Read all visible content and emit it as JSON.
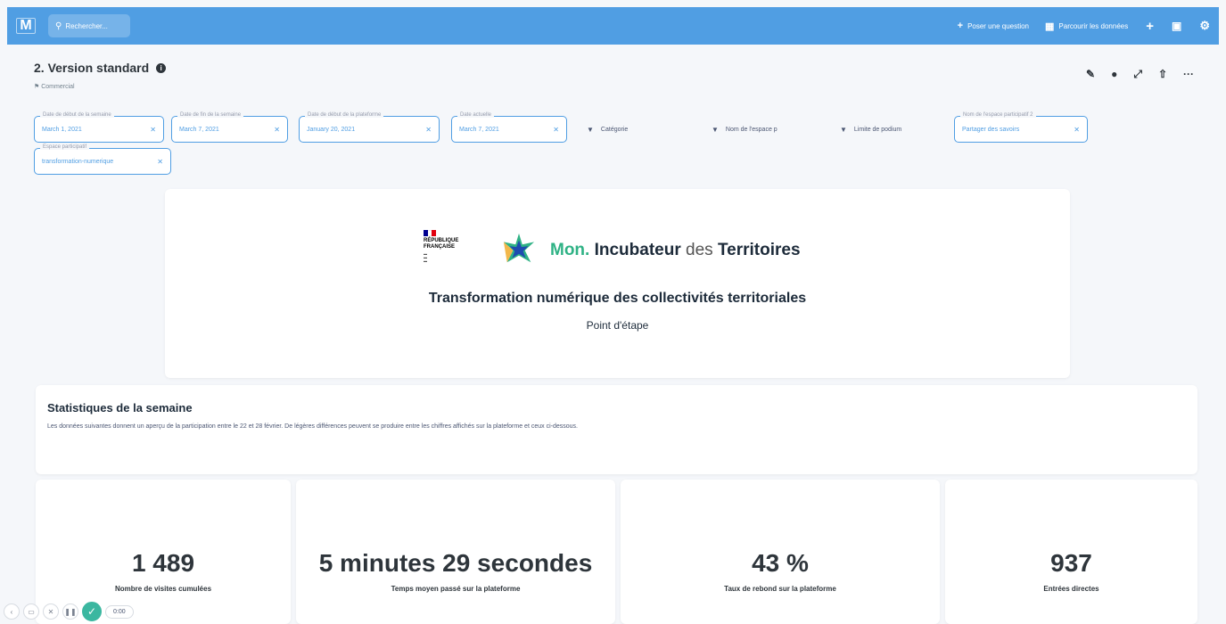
{
  "topbar": {
    "logo": "M",
    "search_placeholder": "Rechercher...",
    "new_question": "Poser une question",
    "browse_data": "Parcourir les données",
    "icons": [
      "plus-icon",
      "dashboard-icon",
      "gear-icon"
    ]
  },
  "header": {
    "title": "2. Version standard",
    "collection": "Commercial"
  },
  "filters": [
    {
      "label": "Date de début de la semaine",
      "value": "March 1, 2021"
    },
    {
      "label": "Date de fin de la semaine",
      "value": "March 7, 2021"
    },
    {
      "label": "Date de début de la plateforme",
      "value": "January 20, 2021"
    },
    {
      "label": "Date actuelle",
      "value": "March 7, 2021"
    },
    {
      "label": "Nom de l'espace participatif 2",
      "value": "Partager des savoirs"
    },
    {
      "label": "Espace participatif",
      "value": "transformation-numerique"
    }
  ],
  "empty_filters": [
    "Catégorie",
    "Nom de l'espace p",
    "Limite de podium"
  ],
  "banner": {
    "rf_line1": "RÉPUBLIQUE",
    "rf_line2": "FRANÇAISE",
    "brand_mon": "Mon.",
    "brand_inc": "Incubateur",
    "brand_des": " des ",
    "brand_ter": "Territoires",
    "title": "Transformation numérique des collectivités territoriales",
    "subtitle": "Point d'étape"
  },
  "stats": {
    "title": "Statistiques de la semaine",
    "description": "Les données suivantes donnent un aperçu de la participation entre le 22 et 28 février. De légères différences peuvent se produire entre les chiffres affichés sur la plateforme et ceux ci-dessous."
  },
  "kpis": [
    {
      "value": "1 489",
      "label": "Nombre de visites cumulées"
    },
    {
      "value": "5 minutes 29 secondes",
      "label": "Temps moyen passé sur la plateforme"
    },
    {
      "value": "43 %",
      "label": "Taux de rebond sur la plateforme"
    },
    {
      "value": "937",
      "label": "Entrées directes"
    }
  ],
  "player": {
    "time": "0:00"
  },
  "colors": {
    "brand_blue": "#509ee3",
    "incubator_green": "#2fb285"
  }
}
